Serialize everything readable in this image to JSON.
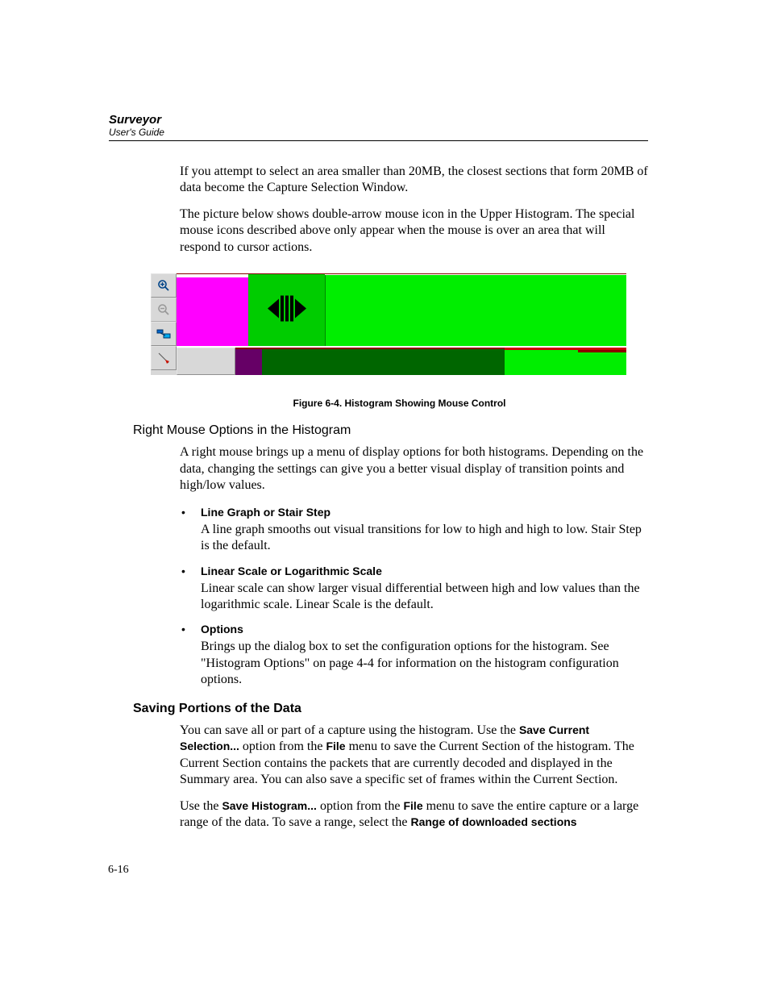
{
  "header": {
    "title": "Surveyor",
    "subtitle": "User's Guide"
  },
  "intro_p1": "If you attempt to select an area smaller than 20MB, the closest sections that form 20MB of data become the Capture Selection Window.",
  "intro_p2": "The picture below shows double-arrow mouse icon in the Upper Histogram. The special mouse icons described above only appear when the mouse is over an area that will respond to cursor actions.",
  "figure_caption": "Figure 6-4.  Histogram Showing Mouse Control",
  "sub_heading": "Right Mouse Options in the Histogram",
  "sub_intro": "A right mouse brings up a menu of display options for both histograms. Depending on the data, changing the settings can give you a better visual display of transition points and high/low values.",
  "options": [
    {
      "title": "Line Graph or Stair Step",
      "body": "A line graph smooths out visual transitions for low to high and high to low. Stair Step is the default."
    },
    {
      "title": "Linear Scale or Logarithmic Scale",
      "body": "Linear scale can show larger visual differential between high and low values than the logarithmic scale. Linear Scale is the default."
    },
    {
      "title": "Options",
      "body": "Brings up the dialog box to set the configuration options for the histogram. See \"Histogram Options\" on page 4-4 for information on the histogram configuration options."
    }
  ],
  "section_heading": "Saving Portions of the Data",
  "save": {
    "p1_pre": "You can save all or part of a capture using the histogram. Use the ",
    "p1_b1": "Save Current Selection...",
    "p1_mid": " option from the ",
    "p1_b2": "File",
    "p1_post": " menu to save the Current Section of the histogram. The Current Section contains the packets that are currently decoded and displayed in the Summary area. You can also save a specific set of frames within the Current Section.",
    "p2_pre": "Use the ",
    "p2_b1": "Save Histogram...",
    "p2_mid": " option from the ",
    "p2_b2": "File",
    "p2_post": " menu to save the entire capture or a large range of the data. To save a range, select the ",
    "p2_b3": "Range of downloaded sections"
  },
  "page_number": "6-16",
  "toolbar_icons": {
    "zoom_in": "zoom-in-icon",
    "zoom_out": "zoom-out-icon",
    "fit": "fit-view-icon",
    "marker": "marker-tool-icon"
  }
}
